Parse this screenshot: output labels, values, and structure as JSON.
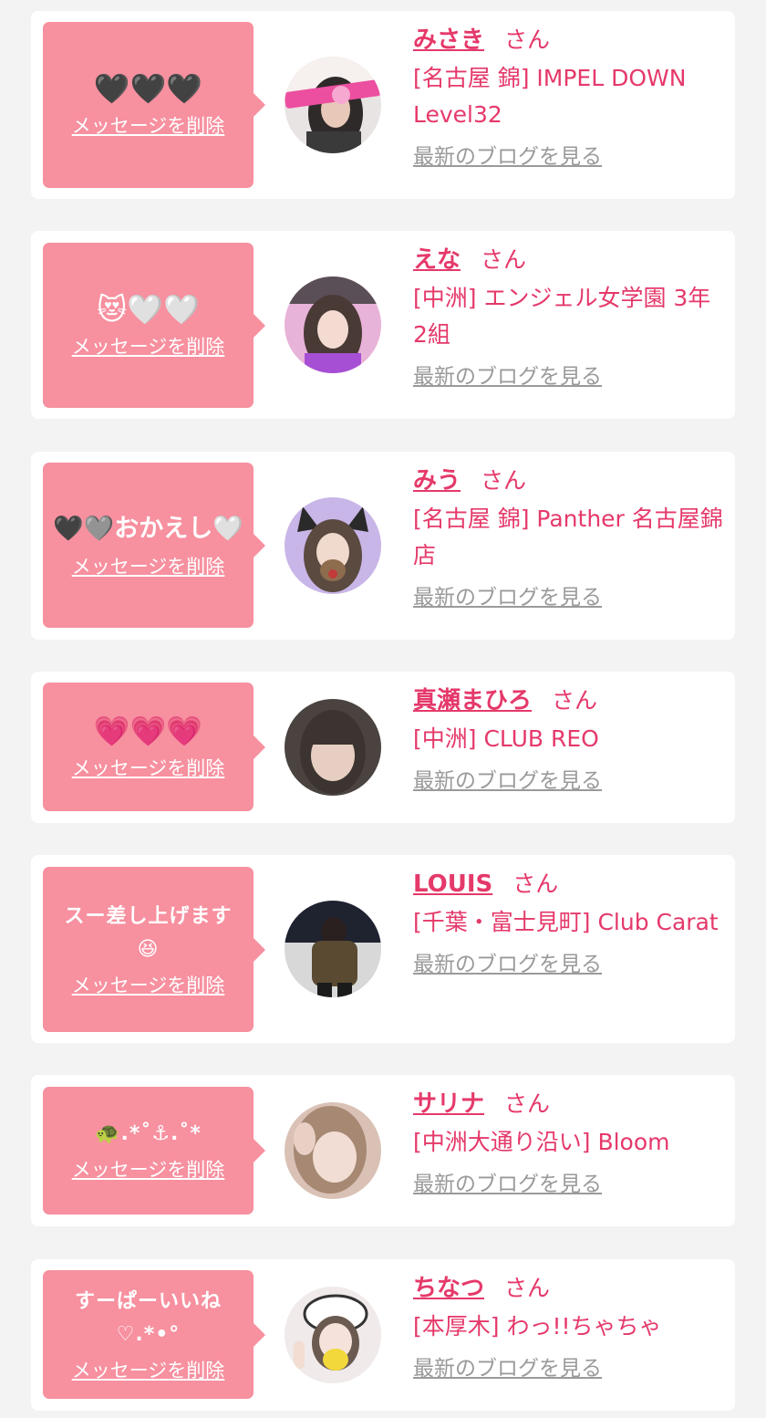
{
  "common": {
    "delete_label": "メッセージを削除",
    "blog_label": "最新のブログを見る",
    "honorific": "さん"
  },
  "items": [
    {
      "message": "🖤🖤🖤",
      "name": "みさき",
      "shop": "[名古屋 錦] IMPEL DOWN Level32",
      "avatar_colors": [
        "#3a3a3a",
        "#ec4fa0"
      ]
    },
    {
      "message": "😻🤍🤍",
      "name": "えな",
      "shop": "[中洲] エンジェル女学園 3年2組",
      "avatar_colors": [
        "#e8b3d8",
        "#a64fd4"
      ]
    },
    {
      "message": "🖤🩶おかえし🤍",
      "name": "みう",
      "shop": "[名古屋 錦] Panther 名古屋錦店",
      "avatar_colors": [
        "#c9b6e8",
        "#8e6c4e"
      ]
    },
    {
      "message": "💗💗💗",
      "name": "真瀬まひろ",
      "shop": "[中洲] CLUB REO",
      "avatar_colors": [
        "#4a4340",
        "#e6cfc2"
      ]
    },
    {
      "message": "スー差し上げます\n😆",
      "name": "LOUIS",
      "shop": "[千葉・富士見町] Club Carat",
      "avatar_colors": [
        "#d8d8d8",
        "#5a4a32"
      ]
    },
    {
      "message": "🐢.*˚⚓︎.˚*",
      "name": "サリナ",
      "shop": "[中洲大通り沿い] Bloom",
      "avatar_colors": [
        "#d9c1b5",
        "#a68873"
      ]
    },
    {
      "message": "すーぱーいいね\n♡.*•°",
      "name": "ちなつ",
      "shop": "[本厚木] わっ!!ちゃちゃ",
      "avatar_colors": [
        "#f0eaea",
        "#f3d83c"
      ]
    }
  ]
}
